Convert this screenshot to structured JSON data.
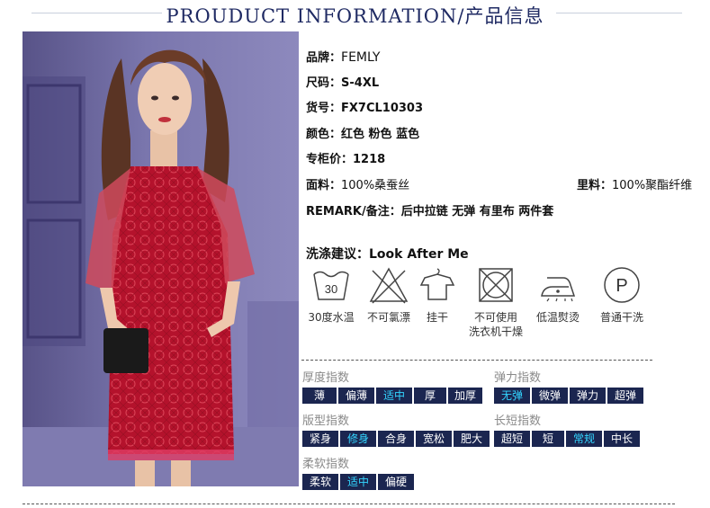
{
  "header": {
    "title": "PROUDUCT INFORMATION/产品信息"
  },
  "product": {
    "brand_label": "品牌：",
    "brand": "FEMLY",
    "size_label": "尺码：",
    "size": "S-4XL",
    "sku_label": "货号：",
    "sku": "FX7CL10303",
    "color_label": "颜色：",
    "colors": "红色 粉色 蓝色",
    "price_label": "专柜价：",
    "price": "1218",
    "fabric_label": "面料：",
    "fabric": "100%桑蚕丝",
    "lining_label": "里料：",
    "lining": "100%聚酯纤维",
    "remark_label": "REMARK/备注：",
    "remark": "后中拉链 无弹 有里布 两件套"
  },
  "care": {
    "label": "洗涤建议：",
    "value": "Look After Me",
    "items": [
      {
        "icon": "wash-30-icon",
        "text": "30",
        "caption": "30度水温"
      },
      {
        "icon": "no-bleach-icon",
        "caption": "不可氯漂"
      },
      {
        "icon": "hang-dry-icon",
        "caption": "挂干"
      },
      {
        "icon": "no-tumble-dry-icon",
        "caption": "不可使用",
        "caption2": "洗衣机干燥"
      },
      {
        "icon": "iron-low-icon",
        "caption": "低温熨烫"
      },
      {
        "icon": "dry-clean-p-icon",
        "text": "P",
        "caption": "普通干洗"
      }
    ]
  },
  "indices": {
    "thickness": {
      "title": "厚度指数",
      "options": [
        "薄",
        "偏薄",
        "适中",
        "厚",
        "加厚"
      ],
      "selected": "适中"
    },
    "elasticity": {
      "title": "弹力指数",
      "options": [
        "无弹",
        "微弹",
        "弹力",
        "超弹"
      ],
      "selected": "无弹"
    },
    "fit": {
      "title": "版型指数",
      "options": [
        "紧身",
        "修身",
        "合身",
        "宽松",
        "肥大"
      ],
      "selected": "修身"
    },
    "length": {
      "title": "长短指数",
      "options": [
        "超短",
        "短",
        "常规",
        "中长"
      ],
      "selected": "常规"
    },
    "softness": {
      "title": "柔软指数",
      "options": [
        "柔软",
        "适中",
        "偏硬"
      ],
      "selected": "适中"
    }
  },
  "colors": {
    "header_text": "#1f2a63",
    "chip_bg": "#1b2650",
    "chip_selected_text": "#33d6ff"
  }
}
